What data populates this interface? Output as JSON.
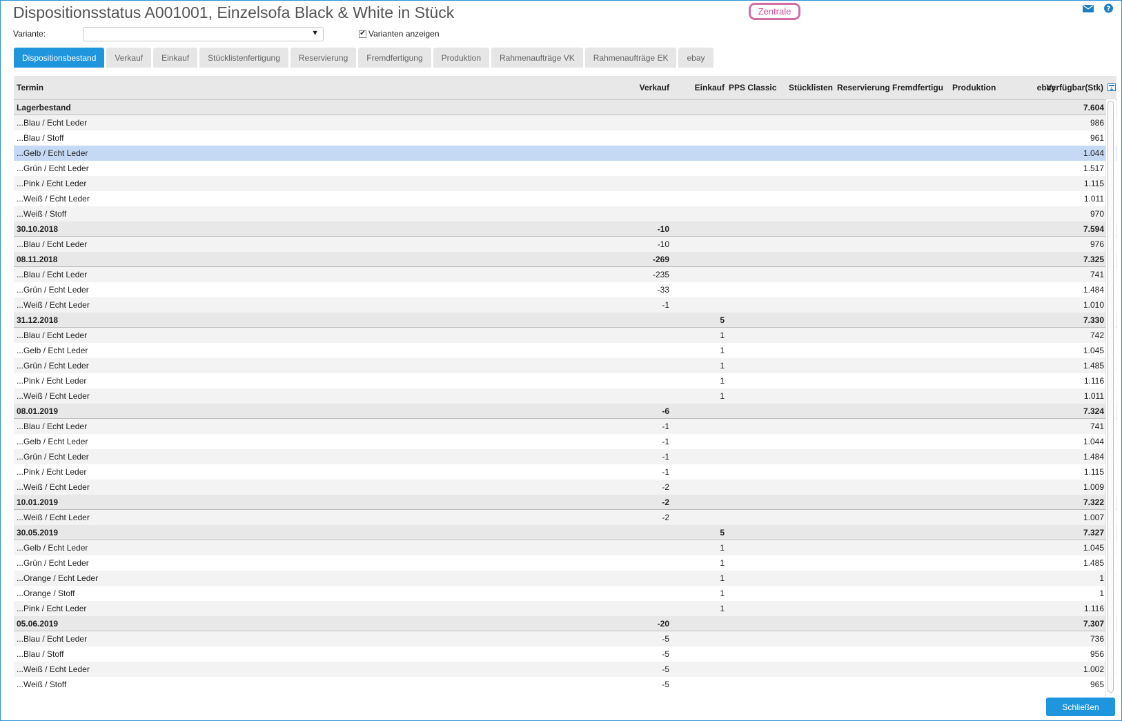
{
  "header": {
    "title": "Dispositionsstatus A001001, Einzelsofa Black & White in Stück",
    "zentrale_label": "Zentrale",
    "accent_color": "#1f95de",
    "zentrale_color": "#cf6fa5"
  },
  "filters": {
    "variante_label": "Variante:",
    "variante_value": "",
    "show_variants_label": "Varianten anzeigen",
    "show_variants_checked": true
  },
  "tabs": [
    {
      "label": "Dispositionsbestand",
      "active": true
    },
    {
      "label": "Verkauf",
      "active": false
    },
    {
      "label": "Einkauf",
      "active": false
    },
    {
      "label": "Stücklistenfertigung",
      "active": false
    },
    {
      "label": "Reservierung",
      "active": false
    },
    {
      "label": "Fremdfertigung",
      "active": false
    },
    {
      "label": "Produktion",
      "active": false
    },
    {
      "label": "Rahmenaufträge VK",
      "active": false
    },
    {
      "label": "Rahmenaufträge EK",
      "active": false
    },
    {
      "label": "ebay",
      "active": false
    }
  ],
  "table": {
    "columns": {
      "termin": "Termin",
      "verkauf": "Verkauf",
      "einkauf": "Einkauf",
      "pps": "PPS Classic",
      "stuecklisten": "Stücklisten",
      "reservierung": "Reservierung",
      "fremdfertigung": "Fremdfertigu",
      "produktion": "Produktion",
      "ebay": "ebay",
      "verfuegbar": "Verfügbar(Stk)"
    },
    "rows": [
      {
        "type": "group",
        "label": "Lagerbestand",
        "verkauf": "",
        "einkauf": "",
        "verfuegbar": "7.604"
      },
      {
        "type": "item",
        "label": "...Blau / Echt Leder",
        "verkauf": "",
        "einkauf": "",
        "verfuegbar": "986"
      },
      {
        "type": "item",
        "label": "...Blau / Stoff",
        "verkauf": "",
        "einkauf": "",
        "verfuegbar": "961"
      },
      {
        "type": "item",
        "label": "...Gelb / Echt Leder",
        "verkauf": "",
        "einkauf": "",
        "verfuegbar": "1.044",
        "selected": true
      },
      {
        "type": "item",
        "label": "...Grün / Echt Leder",
        "verkauf": "",
        "einkauf": "",
        "verfuegbar": "1.517"
      },
      {
        "type": "item",
        "label": "...Pink / Echt Leder",
        "verkauf": "",
        "einkauf": "",
        "verfuegbar": "1.115"
      },
      {
        "type": "item",
        "label": "...Weiß / Echt Leder",
        "verkauf": "",
        "einkauf": "",
        "verfuegbar": "1.011"
      },
      {
        "type": "item",
        "label": "...Weiß / Stoff",
        "verkauf": "",
        "einkauf": "",
        "verfuegbar": "970"
      },
      {
        "type": "group",
        "label": "30.10.2018",
        "verkauf": "-10",
        "einkauf": "",
        "verfuegbar": "7.594"
      },
      {
        "type": "item",
        "label": "...Blau / Echt Leder",
        "verkauf": "-10",
        "einkauf": "",
        "verfuegbar": "976"
      },
      {
        "type": "group",
        "label": "08.11.2018",
        "verkauf": "-269",
        "einkauf": "",
        "verfuegbar": "7.325"
      },
      {
        "type": "item",
        "label": "...Blau / Echt Leder",
        "verkauf": "-235",
        "einkauf": "",
        "verfuegbar": "741"
      },
      {
        "type": "item",
        "label": "...Grün / Echt Leder",
        "verkauf": "-33",
        "einkauf": "",
        "verfuegbar": "1.484"
      },
      {
        "type": "item",
        "label": "...Weiß / Echt Leder",
        "verkauf": "-1",
        "einkauf": "",
        "verfuegbar": "1.010"
      },
      {
        "type": "group",
        "label": "31.12.2018",
        "verkauf": "",
        "einkauf": "5",
        "verfuegbar": "7.330"
      },
      {
        "type": "item",
        "label": "...Blau / Echt Leder",
        "verkauf": "",
        "einkauf": "1",
        "verfuegbar": "742"
      },
      {
        "type": "item",
        "label": "...Gelb / Echt Leder",
        "verkauf": "",
        "einkauf": "1",
        "verfuegbar": "1.045"
      },
      {
        "type": "item",
        "label": "...Grün / Echt Leder",
        "verkauf": "",
        "einkauf": "1",
        "verfuegbar": "1.485"
      },
      {
        "type": "item",
        "label": "...Pink / Echt Leder",
        "verkauf": "",
        "einkauf": "1",
        "verfuegbar": "1.116"
      },
      {
        "type": "item",
        "label": "...Weiß / Echt Leder",
        "verkauf": "",
        "einkauf": "1",
        "verfuegbar": "1.011"
      },
      {
        "type": "group",
        "label": "08.01.2019",
        "verkauf": "-6",
        "einkauf": "",
        "verfuegbar": "7.324"
      },
      {
        "type": "item",
        "label": "...Blau / Echt Leder",
        "verkauf": "-1",
        "einkauf": "",
        "verfuegbar": "741"
      },
      {
        "type": "item",
        "label": "...Gelb / Echt Leder",
        "verkauf": "-1",
        "einkauf": "",
        "verfuegbar": "1.044"
      },
      {
        "type": "item",
        "label": "...Grün / Echt Leder",
        "verkauf": "-1",
        "einkauf": "",
        "verfuegbar": "1.484"
      },
      {
        "type": "item",
        "label": "...Pink / Echt Leder",
        "verkauf": "-1",
        "einkauf": "",
        "verfuegbar": "1.115"
      },
      {
        "type": "item",
        "label": "...Weiß / Echt Leder",
        "verkauf": "-2",
        "einkauf": "",
        "verfuegbar": "1.009"
      },
      {
        "type": "group",
        "label": "10.01.2019",
        "verkauf": "-2",
        "einkauf": "",
        "verfuegbar": "7.322"
      },
      {
        "type": "item",
        "label": "...Weiß / Echt Leder",
        "verkauf": "-2",
        "einkauf": "",
        "verfuegbar": "1.007"
      },
      {
        "type": "group",
        "label": "30.05.2019",
        "verkauf": "",
        "einkauf": "5",
        "verfuegbar": "7.327"
      },
      {
        "type": "item",
        "label": "...Gelb / Echt Leder",
        "verkauf": "",
        "einkauf": "1",
        "verfuegbar": "1.045"
      },
      {
        "type": "item",
        "label": "...Grün / Echt Leder",
        "verkauf": "",
        "einkauf": "1",
        "verfuegbar": "1.485"
      },
      {
        "type": "item",
        "label": "...Orange / Echt Leder",
        "verkauf": "",
        "einkauf": "1",
        "verfuegbar": "1"
      },
      {
        "type": "item",
        "label": "...Orange / Stoff",
        "verkauf": "",
        "einkauf": "1",
        "verfuegbar": "1"
      },
      {
        "type": "item",
        "label": "...Pink / Echt Leder",
        "verkauf": "",
        "einkauf": "1",
        "verfuegbar": "1.116"
      },
      {
        "type": "group",
        "label": "05.06.2019",
        "verkauf": "-20",
        "einkauf": "",
        "verfuegbar": "7.307"
      },
      {
        "type": "item",
        "label": "...Blau / Echt Leder",
        "verkauf": "-5",
        "einkauf": "",
        "verfuegbar": "736"
      },
      {
        "type": "item",
        "label": "...Blau / Stoff",
        "verkauf": "-5",
        "einkauf": "",
        "verfuegbar": "956"
      },
      {
        "type": "item",
        "label": "...Weiß / Echt Leder",
        "verkauf": "-5",
        "einkauf": "",
        "verfuegbar": "1.002"
      },
      {
        "type": "item",
        "label": "...Weiß / Stoff",
        "verkauf": "-5",
        "einkauf": "",
        "verfuegbar": "965"
      }
    ]
  },
  "footer": {
    "close_label": "Schließen"
  },
  "icons": {
    "mail": "mail-icon",
    "help": "help-icon",
    "export": "export-icon",
    "dropdown": "chevron-down-icon"
  }
}
